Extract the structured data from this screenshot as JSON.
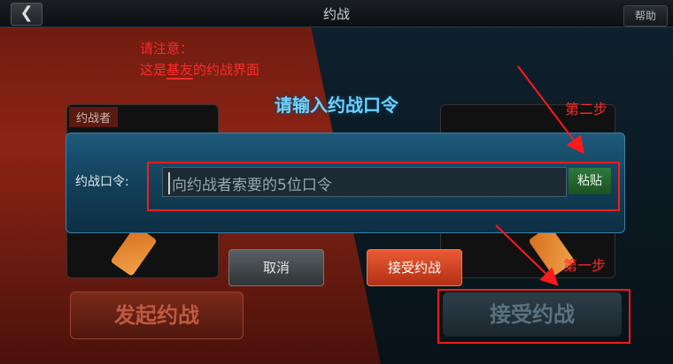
{
  "header": {
    "title": "约战",
    "back_icon": "chevron-left-icon",
    "help_label": "帮助"
  },
  "notes": {
    "line1": "请注意：",
    "line2_pre": "这是",
    "line2_highlight": "基友",
    "line2_post": "的约战界面"
  },
  "cards": {
    "left_tag": "约战者"
  },
  "dialog": {
    "title": "请输入约战口令",
    "field_label": "约战口令:",
    "input_placeholder": "向约战者索要的5位口令",
    "paste_label": "粘贴",
    "cancel_label": "取消",
    "accept_label": "接受约战"
  },
  "bottom": {
    "start_label": "发起约战",
    "accept_label": "接受约战"
  },
  "annotations": {
    "step2": "第二步",
    "step1": "第一步"
  }
}
